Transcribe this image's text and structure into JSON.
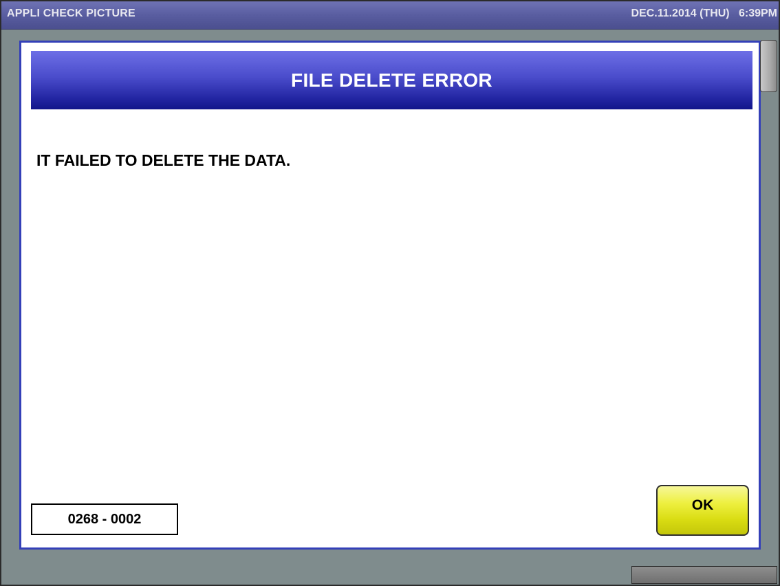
{
  "titlebar": {
    "app_title": "APPLI CHECK PICTURE",
    "datetime": "DEC.11.2014 (THU)   6:39PM"
  },
  "dialog": {
    "title": "FILE DELETE ERROR",
    "message": "IT FAILED TO DELETE THE DATA.",
    "error_code": "0268 - 0002",
    "ok_label": "OK"
  },
  "colors": {
    "header_blue": "#2427a4",
    "dialog_border": "#3440b8",
    "ok_button_yellow": "#eef040",
    "background_gray": "#7f8c8d"
  }
}
